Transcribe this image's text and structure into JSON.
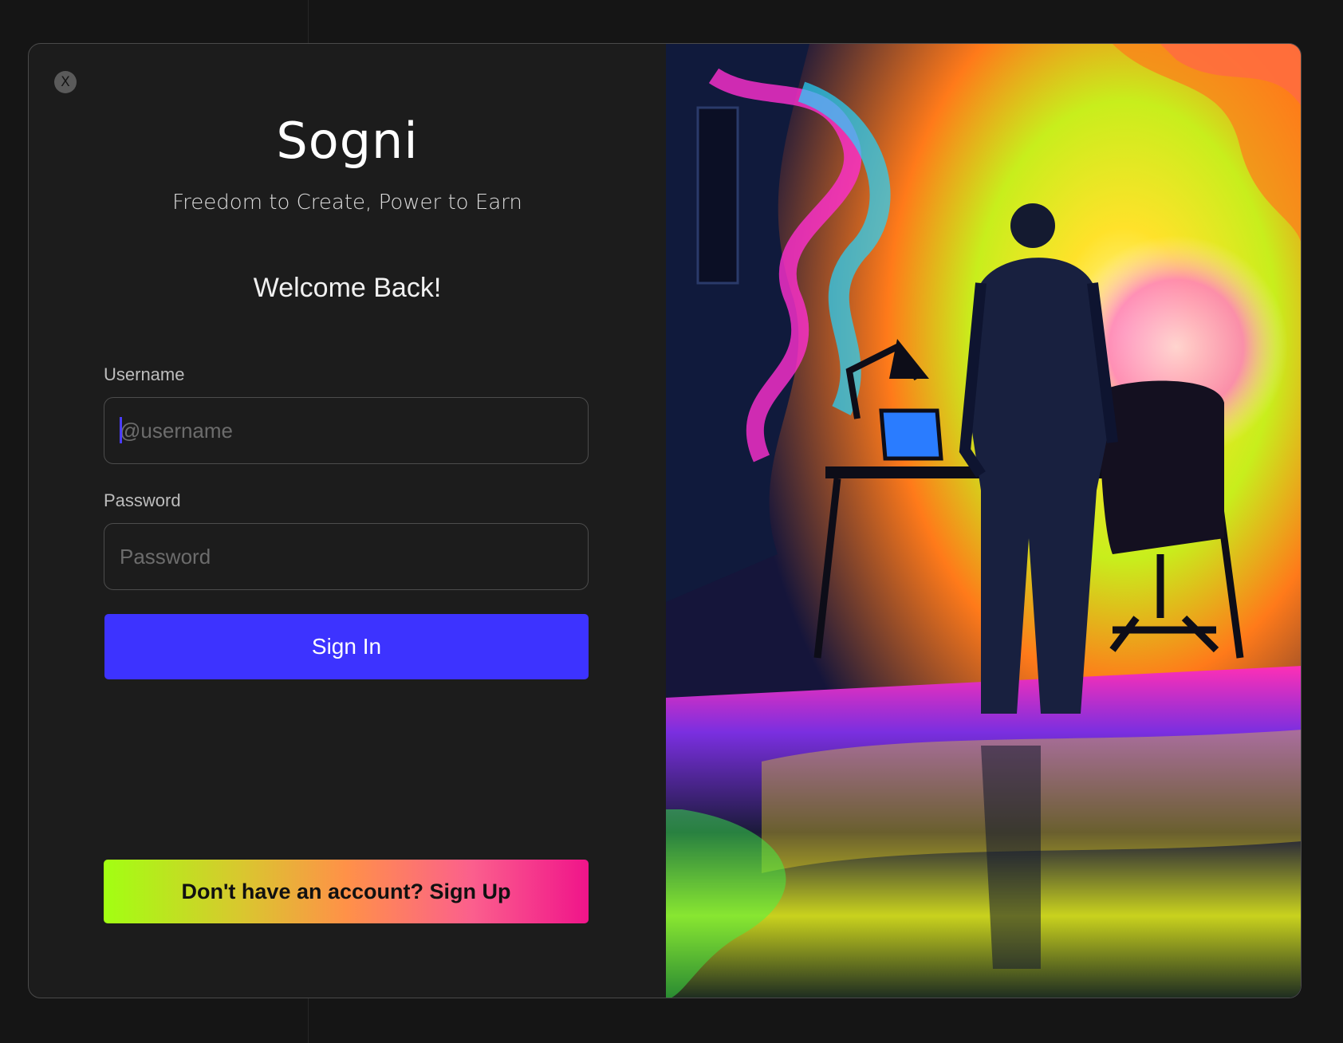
{
  "app": {
    "brand": "Sogni",
    "tagline": "Freedom to Create, Power to Earn"
  },
  "modal": {
    "close_label": "X",
    "welcome": "Welcome Back!"
  },
  "form": {
    "username_label": "Username",
    "username_placeholder": "@username",
    "username_value": "",
    "password_label": "Password",
    "password_placeholder": "Password",
    "password_value": "",
    "signin_label": "Sign In",
    "signup_label": "Don't have an account? Sign Up"
  },
  "theme": {
    "accent": "#3d33ff",
    "signup_gradient": [
      "#a2ff12",
      "#ff9148",
      "#f0148a"
    ],
    "background": "#151515",
    "panel": "#1c1c1c"
  },
  "artwork": {
    "icon": "artwork-image"
  }
}
